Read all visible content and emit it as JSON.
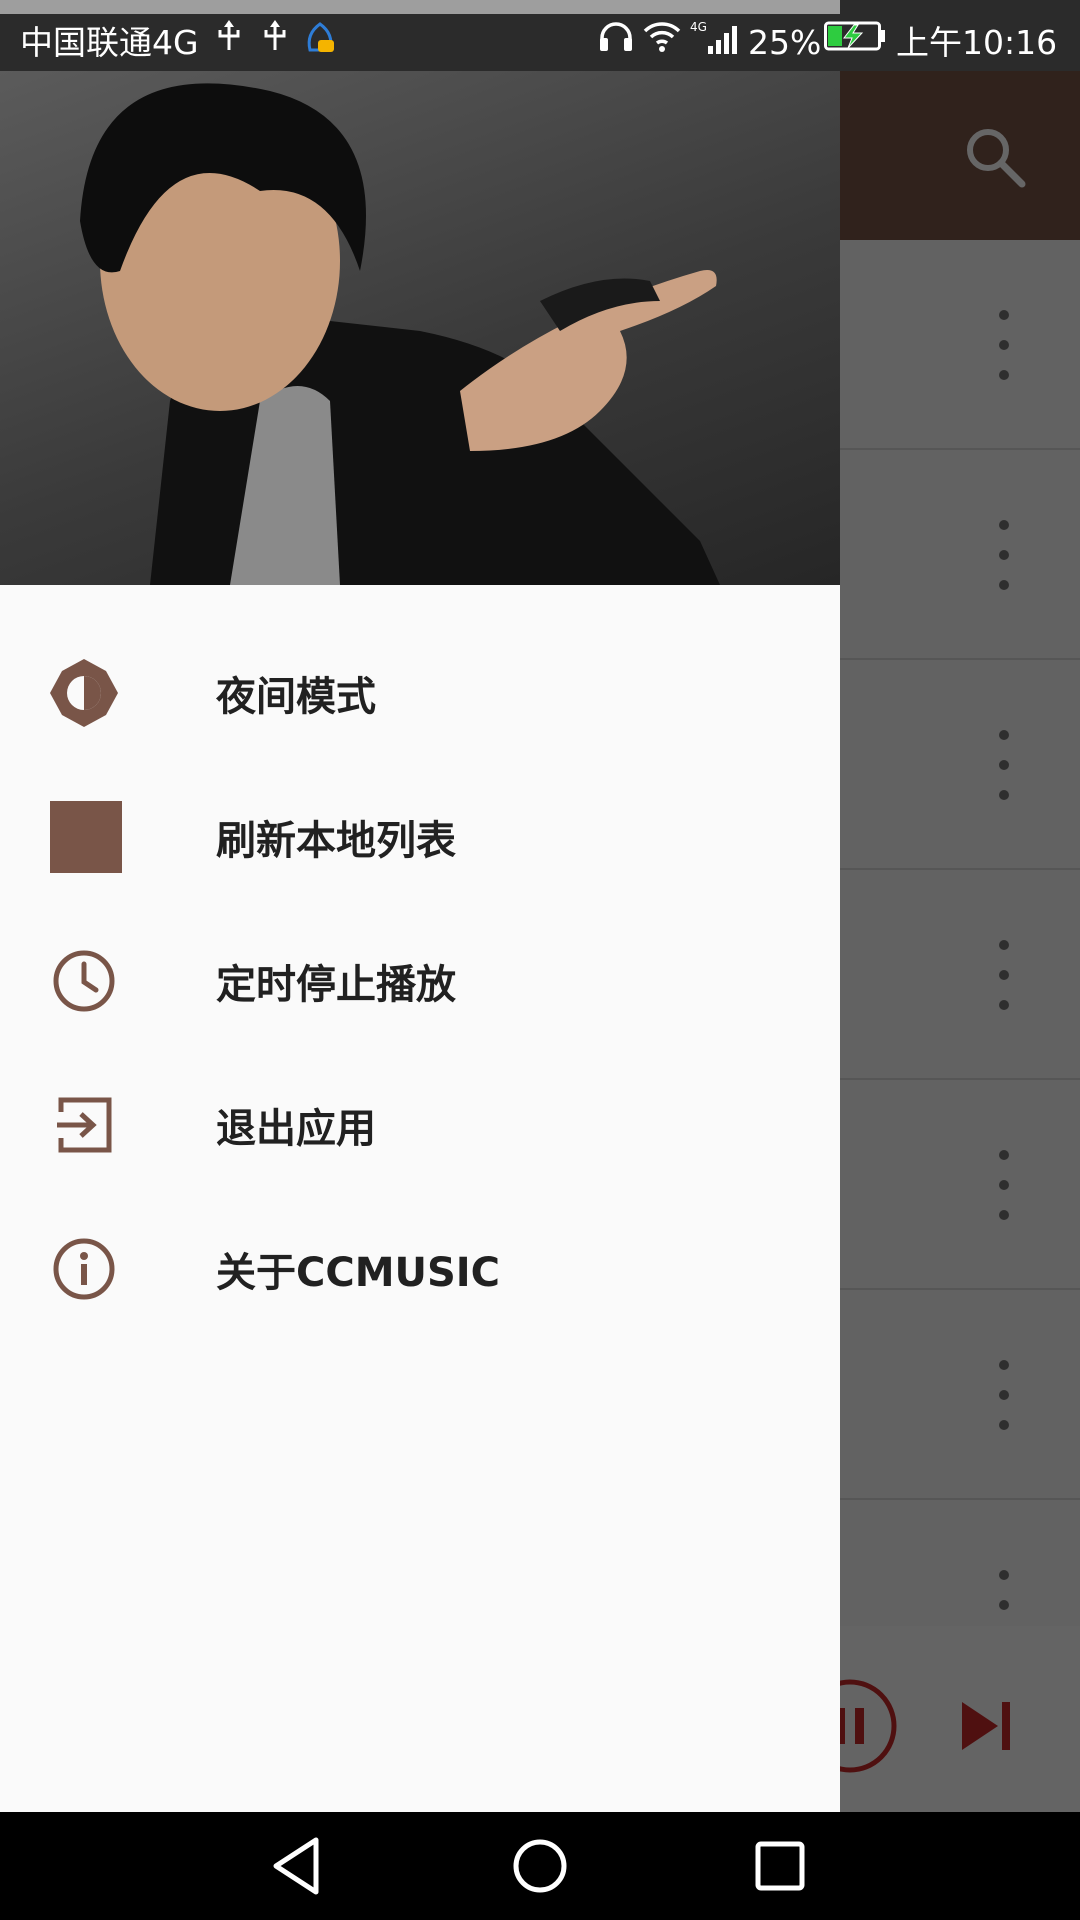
{
  "status_bar": {
    "carrier": "中国联通4G",
    "battery_percent": "25%",
    "time": "上午10:16",
    "icons": [
      "usb-icon",
      "usb-icon",
      "notification-app-icon",
      "headphones-icon",
      "wifi-icon",
      "4g-signal-icon",
      "battery-charging-icon"
    ]
  },
  "drawer": {
    "header_image": "artist-photo",
    "menu": [
      {
        "label": "夜间模式",
        "icon": "brightness-icon"
      },
      {
        "label": "刷新本地列表",
        "icon": "square-icon"
      },
      {
        "label": "定时停止播放",
        "icon": "clock-icon"
      },
      {
        "label": "退出应用",
        "icon": "exit-icon"
      },
      {
        "label": "关于CCMUSIC",
        "icon": "info-icon"
      }
    ]
  },
  "background_app": {
    "toolbar_icons": [
      "search-icon"
    ],
    "row_icons": [
      "more-vert-icon"
    ],
    "player_icons": [
      "pause-icon",
      "skip-next-icon"
    ]
  },
  "nav_bar": {
    "icons": [
      "back-icon",
      "home-icon",
      "recents-icon"
    ]
  },
  "colors": {
    "primary": "#795548",
    "accent": "#c62828",
    "drawer_bg": "#fafafa",
    "menu_text": "#212121"
  }
}
